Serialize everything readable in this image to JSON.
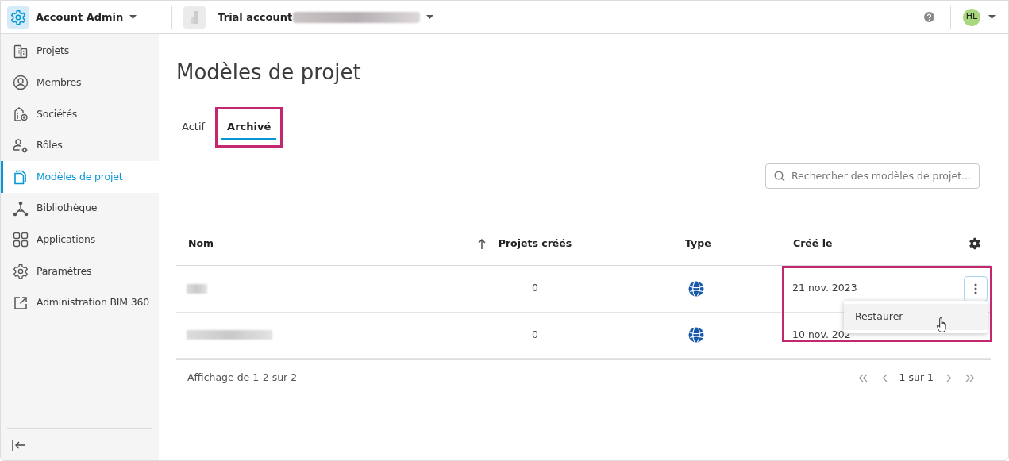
{
  "header": {
    "app_title": "Account Admin",
    "account_label": "Trial account",
    "avatar_initials": "HL"
  },
  "sidebar": {
    "items": [
      {
        "label": "Projets",
        "selected": false
      },
      {
        "label": "Membres",
        "selected": false
      },
      {
        "label": "Sociétés",
        "selected": false
      },
      {
        "label": "Rôles",
        "selected": false
      },
      {
        "label": "Modèles de projet",
        "selected": true
      },
      {
        "label": "Bibliothèque",
        "selected": false
      },
      {
        "label": "Applications",
        "selected": false
      },
      {
        "label": "Paramètres",
        "selected": false
      },
      {
        "label": "Administration BIM 360",
        "selected": false
      }
    ]
  },
  "page_title": "Modèles de projet",
  "tabs": [
    {
      "label": "Actif",
      "selected": false,
      "highlighted": false
    },
    {
      "label": "Archivé",
      "selected": true,
      "highlighted": true
    }
  ],
  "search": {
    "placeholder": "Rechercher des modèles de projet..."
  },
  "table": {
    "columns": [
      "Nom",
      "Projets créés",
      "Type",
      "Créé le"
    ],
    "rows": [
      {
        "projects_created": "0",
        "type": {
          "kind": "globe"
        },
        "created": "21 nov. 2023",
        "menu_open": true
      },
      {
        "projects_created": "0",
        "type": {
          "kind": "globe"
        },
        "created": "10 nov. 202",
        "menu_open": false
      }
    ]
  },
  "row_menu": {
    "items": [
      "Restaurer"
    ]
  },
  "footer": {
    "summary": "Affichage de 1-2 sur 2",
    "page": "1 sur 1"
  }
}
